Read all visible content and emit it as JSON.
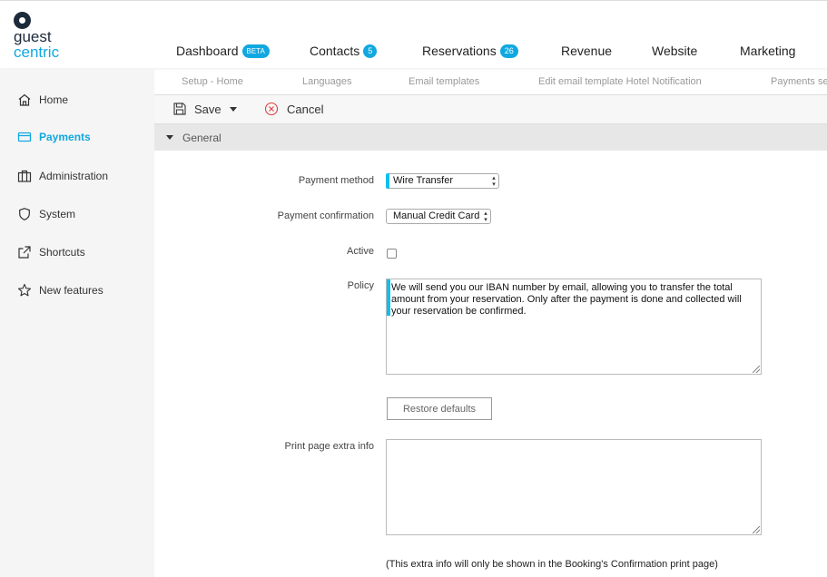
{
  "brand": {
    "line1": "guest",
    "line2": "centric"
  },
  "mainnav": [
    {
      "label": "Dashboard",
      "badge": "BETA"
    },
    {
      "label": "Contacts",
      "badge": "5"
    },
    {
      "label": "Reservations",
      "badge": "26"
    },
    {
      "label": "Revenue",
      "badge": ""
    },
    {
      "label": "Website",
      "badge": ""
    },
    {
      "label": "Marketing",
      "badge": ""
    }
  ],
  "subnav": [
    "Setup - Home",
    "Languages",
    "Email templates",
    "Edit email template Hotel Notification",
    "Payments se"
  ],
  "sidebar": {
    "items": [
      {
        "label": "Home",
        "icon": "home-icon"
      },
      {
        "label": "Payments",
        "icon": "card-icon"
      },
      {
        "label": "Administration",
        "icon": "building-icon"
      },
      {
        "label": "System",
        "icon": "shield-icon"
      },
      {
        "label": "Shortcuts",
        "icon": "external-link-icon"
      },
      {
        "label": "New features",
        "icon": "star-icon"
      }
    ],
    "active": "Payments",
    "accent": "#10a8e0"
  },
  "toolbar": {
    "save_label": "Save",
    "cancel_label": "Cancel"
  },
  "section": {
    "title": "General"
  },
  "form": {
    "payment_method_label": "Payment method",
    "payment_method_value": "Wire Transfer",
    "payment_confirmation_label": "Payment confirmation",
    "payment_confirmation_value": "Manual Credit Card",
    "active_label": "Active",
    "active_checked": false,
    "policy_label": "Policy",
    "policy_value": "We will send you our IBAN number by email, allowing you to transfer the total amount from your reservation. Only after the payment is done and collected will your reservation be confirmed.",
    "restore_label": "Restore defaults",
    "print_label": "Print page extra info",
    "print_value": "",
    "print_note": "(This extra info will only be shown in the Booking's Confirmation print page)"
  }
}
